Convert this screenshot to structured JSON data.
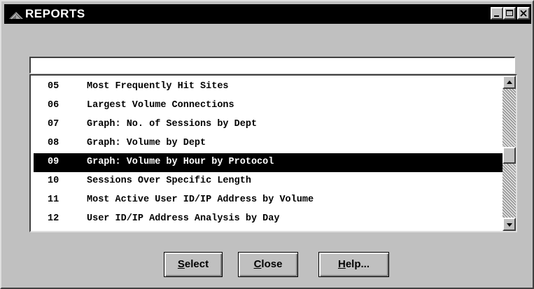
{
  "window": {
    "title": "REPORTS",
    "controls": [
      "minimize",
      "maximize",
      "close"
    ]
  },
  "search": {
    "value": ""
  },
  "list": {
    "columns": [
      "number",
      "report"
    ],
    "items": [
      {
        "num": "05",
        "label": "Most Frequently Hit Sites",
        "selected": false
      },
      {
        "num": "06",
        "label": "Largest Volume Connections",
        "selected": false
      },
      {
        "num": "07",
        "label": "Graph: No. of Sessions by Dept",
        "selected": false
      },
      {
        "num": "08",
        "label": "Graph: Volume by Dept",
        "selected": false
      },
      {
        "num": "09",
        "label": "Graph: Volume by Hour by Protocol",
        "selected": true
      },
      {
        "num": "10",
        "label": "Sessions Over Specific Length",
        "selected": false
      },
      {
        "num": "11",
        "label": "Most Active User ID/IP Address by Volume",
        "selected": false
      },
      {
        "num": "12",
        "label": "User ID/IP Address Analysis by Day",
        "selected": false
      }
    ]
  },
  "buttons": {
    "select": {
      "first": "S",
      "rest": "elect"
    },
    "close": {
      "first": "C",
      "rest": "lose"
    },
    "help": {
      "first": "H",
      "rest": "elp..."
    }
  },
  "colors": {
    "face": "#c0c0c0",
    "title_bg": "#000000",
    "title_fg": "#ffffff",
    "selection_bg": "#000000",
    "selection_fg": "#ffffff"
  }
}
